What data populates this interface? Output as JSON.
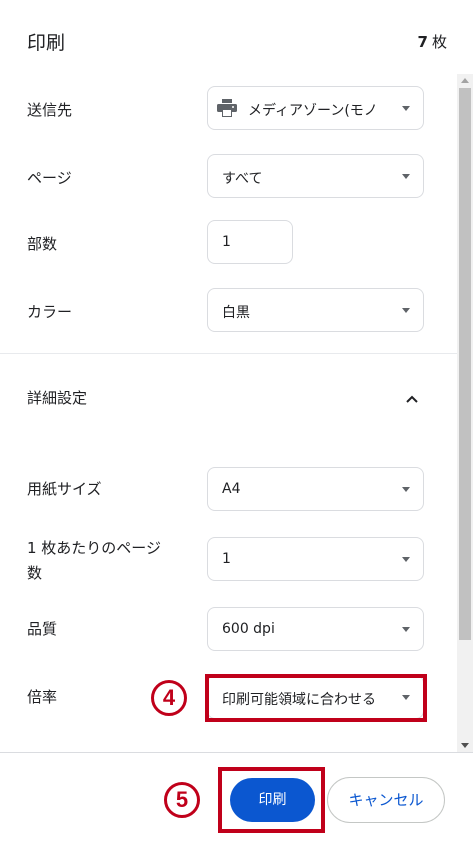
{
  "header": {
    "title": "印刷",
    "sheet_count": "7",
    "sheet_unit": "枚"
  },
  "destination": {
    "label": "送信先",
    "value": "メディアゾーン(モノ"
  },
  "pages": {
    "label": "ページ",
    "value": "すべて"
  },
  "copies": {
    "label": "部数",
    "value": "1"
  },
  "color": {
    "label": "カラー",
    "value": "白黒"
  },
  "advanced": {
    "label": "詳細設定"
  },
  "paper_size": {
    "label": "用紙サイズ",
    "value": "A4"
  },
  "pages_per_sheet": {
    "label_line1": "1 枚あたりのページ",
    "label_line2": "数",
    "value": "1"
  },
  "quality": {
    "label": "品質",
    "value": "600 dpi"
  },
  "scale": {
    "label": "倍率",
    "value": "印刷可能領域に合わせる"
  },
  "annotations": {
    "step4": "4",
    "step5": "5",
    "highlight_color": "#c0001a"
  },
  "footer": {
    "print_label": "印刷",
    "cancel_label": "キャンセル"
  },
  "colors": {
    "primary": "#0b57d0",
    "text": "#202124",
    "border": "#dadce0"
  }
}
